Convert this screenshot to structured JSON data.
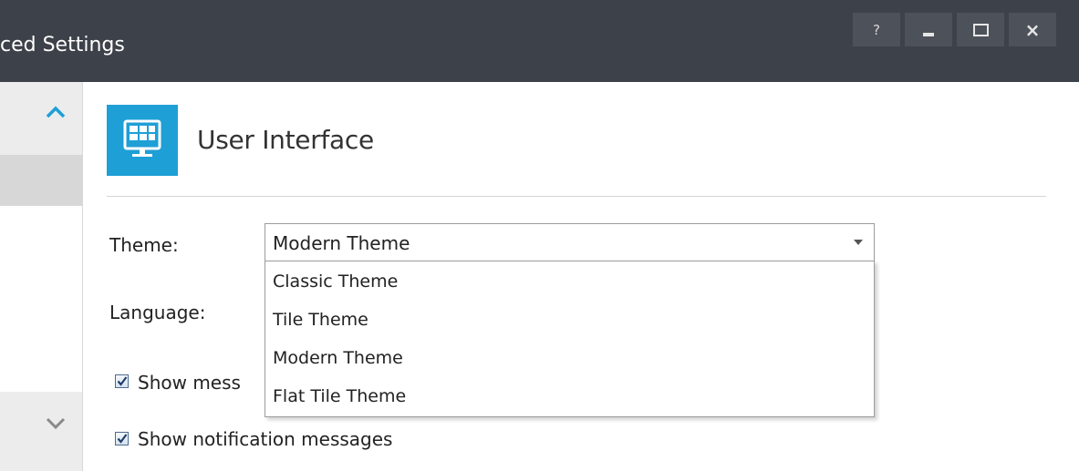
{
  "window": {
    "title": "ced Settings",
    "help_label": "?",
    "close_label": "×"
  },
  "header": {
    "title": "User Interface"
  },
  "form": {
    "theme_label": "Theme:",
    "theme_selected": "Modern Theme",
    "theme_options": [
      "Classic Theme",
      "Tile Theme",
      "Modern Theme",
      "Flat Tile Theme"
    ],
    "language_label": "Language:",
    "show_messages_label": "Show mess",
    "show_messages_checked": true,
    "show_notifications_label": "Show notification messages",
    "show_notifications_checked": true
  },
  "colors": {
    "titlebar": "#3d4149",
    "accent": "#1e9fd6"
  },
  "icons": [
    "chevron-up-icon",
    "chevron-down-icon",
    "dropdown-arrow-icon",
    "monitor-icon",
    "checkmark-icon"
  ]
}
